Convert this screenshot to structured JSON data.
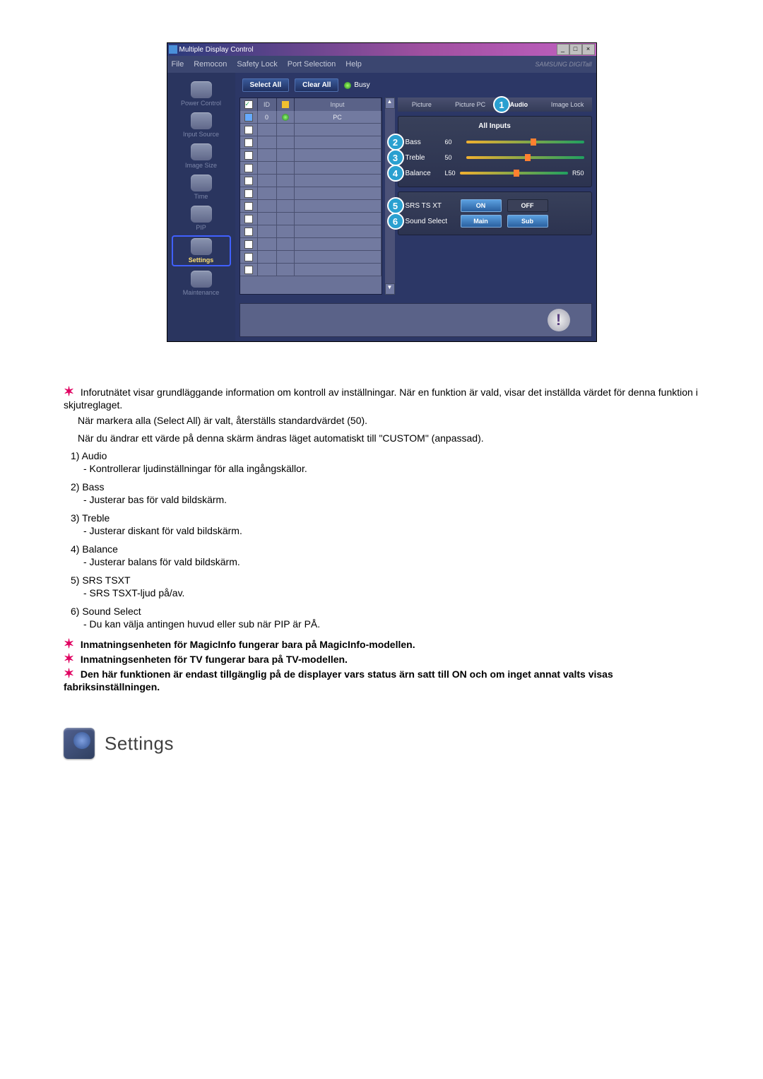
{
  "window": {
    "title": "Multiple Display Control",
    "menus": [
      "File",
      "Remocon",
      "Safety Lock",
      "Port Selection",
      "Help"
    ],
    "brand": "SAMSUNG DIGITall"
  },
  "sidebar": {
    "items": [
      {
        "label": "Power Control"
      },
      {
        "label": "Input Source"
      },
      {
        "label": "Image Size"
      },
      {
        "label": "Time"
      },
      {
        "label": "PIP"
      },
      {
        "label": "Settings",
        "selected": true
      },
      {
        "label": "Maintenance"
      }
    ]
  },
  "toolbar": {
    "select_all": "Select All",
    "clear_all": "Clear All",
    "busy_label": "Busy"
  },
  "grid": {
    "headers": {
      "c1": "✓",
      "c2": "ID",
      "c3": "●",
      "c4": "Input"
    },
    "rows": [
      {
        "chk": "sel",
        "id": "0",
        "dot": true,
        "input": "PC"
      },
      {
        "chk": "",
        "id": "",
        "dot": false,
        "input": ""
      },
      {
        "chk": "",
        "id": "",
        "dot": false,
        "input": ""
      },
      {
        "chk": "",
        "id": "",
        "dot": false,
        "input": ""
      },
      {
        "chk": "",
        "id": "",
        "dot": false,
        "input": ""
      },
      {
        "chk": "",
        "id": "",
        "dot": false,
        "input": ""
      },
      {
        "chk": "",
        "id": "",
        "dot": false,
        "input": ""
      },
      {
        "chk": "",
        "id": "",
        "dot": false,
        "input": ""
      },
      {
        "chk": "",
        "id": "",
        "dot": false,
        "input": ""
      },
      {
        "chk": "",
        "id": "",
        "dot": false,
        "input": ""
      },
      {
        "chk": "",
        "id": "",
        "dot": false,
        "input": ""
      },
      {
        "chk": "",
        "id": "",
        "dot": false,
        "input": ""
      },
      {
        "chk": "",
        "id": "",
        "dot": false,
        "input": ""
      }
    ]
  },
  "tabs": {
    "items": [
      {
        "label": "Picture"
      },
      {
        "label": "Picture PC"
      },
      {
        "label": "Audio",
        "callout": "1",
        "active": true
      },
      {
        "label": "Image Lock"
      }
    ]
  },
  "audio_panel": {
    "title": "All Inputs",
    "sliders": [
      {
        "label": "Bass",
        "val": "60",
        "callout": "2",
        "pos": 55
      },
      {
        "label": "Treble",
        "val": "50",
        "callout": "3",
        "pos": 50
      },
      {
        "label": "Balance",
        "l": "L50",
        "r": "R50",
        "callout": "4",
        "pos": 50
      }
    ],
    "rows": [
      {
        "label": "SRS TS XT",
        "a": "ON",
        "b": "OFF",
        "callout": "5"
      },
      {
        "label": "Sound Select",
        "a": "Main",
        "b": "Sub",
        "callout": "6"
      }
    ]
  },
  "doc": {
    "note1": "Inforutnätet visar grundläggande information om kontroll av inställningar. När en funktion är vald, visar det inställda värdet för denna funktion i skjutreglaget.",
    "note1b": "När markera alla (Select All) är valt, återställs standardvärdet (50).",
    "note1c": "När du ändrar ett värde på denna skärm ändras läget automatiskt till \"CUSTOM\" (anpassad).",
    "items": [
      {
        "h": "1)  Audio",
        "d": "- Kontrollerar ljudinställningar för alla ingångskällor."
      },
      {
        "h": "2)  Bass",
        "d": "- Justerar bas för vald bildskärm."
      },
      {
        "h": "3)  Treble",
        "d": "- Justerar diskant för vald bildskärm."
      },
      {
        "h": "4)  Balance",
        "d": "- Justerar balans för vald bildskärm."
      },
      {
        "h": "5)  SRS TSXT",
        "d": "- SRS TSXT-ljud på/av."
      },
      {
        "h": "6)  Sound Select",
        "d": "- Du kan välja antingen huvud eller sub när PIP är PÅ."
      }
    ],
    "note2": "Inmatningsenheten för MagicInfo fungerar bara på MagicInfo-modellen.",
    "note3": "Inmatningsenheten för TV fungerar bara på TV-modellen.",
    "note4": "Den här funktionen är endast tillgänglig på de displayer vars status ärn satt till ON och om inget annat valts visas fabriksinställningen.",
    "heading": "Settings"
  }
}
